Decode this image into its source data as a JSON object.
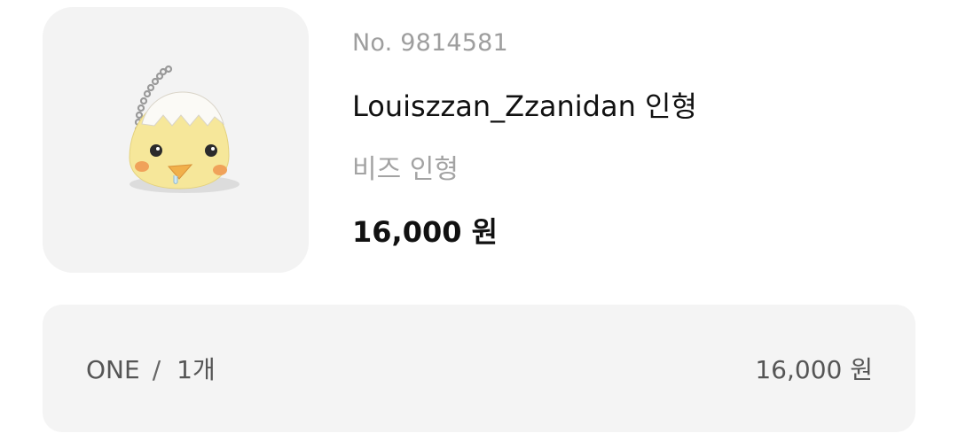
{
  "order": {
    "number_label": "No. 9814581",
    "product_name": "Louiszzan_Zzanidan 인형",
    "category": "비즈 인형",
    "price": "16,000 원"
  },
  "option": {
    "name": "ONE",
    "separator": "/",
    "quantity": "1개",
    "total": "16,000 원"
  },
  "image": {
    "icon": "chick-plush-keychain-icon",
    "body_color": "#f6e79a",
    "cheek_color": "#f0a25a",
    "beak_color": "#f1b04a"
  }
}
